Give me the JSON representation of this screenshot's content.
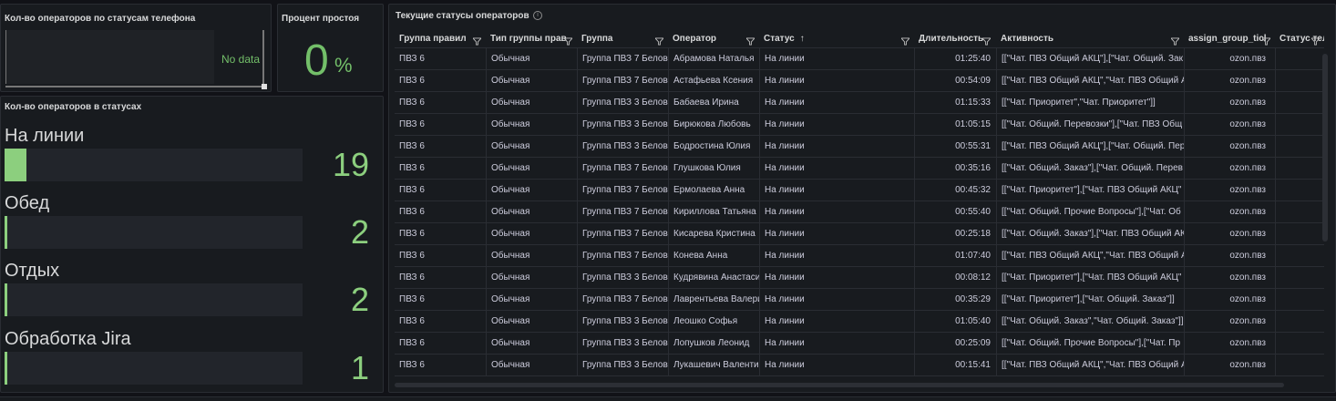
{
  "phone_panel": {
    "title": "Кол-во операторов по статусам телефона",
    "no_data": "No data"
  },
  "idle_panel": {
    "title": "Процент простоя",
    "value": "0",
    "unit": "%"
  },
  "status_panel": {
    "title": "Кол-во операторов в статусах",
    "max": 19,
    "items": [
      {
        "label": "На линии",
        "value": "19",
        "fraction": 0.074
      },
      {
        "label": "Обед",
        "value": "2",
        "fraction": 0.01
      },
      {
        "label": "Отдых",
        "value": "2",
        "fraction": 0.01
      },
      {
        "label": "Обработка Jira",
        "value": "1",
        "fraction": 0.005
      }
    ]
  },
  "table_panel": {
    "title": "Текущие статусы операторов",
    "info_icon": "info-icon",
    "filter_icon": "filter-icon",
    "columns": [
      "Группа правил",
      "Тип группы прав",
      "Группа",
      "Оператор",
      "Статус",
      "Длительность",
      "Активность",
      "assign_group_ticl",
      "Статус теле"
    ],
    "sort_indicator": "↑",
    "rows": [
      [
        "ПВЗ 6",
        "Обычная",
        "Группа ПВЗ 7 Белов",
        "Абрамова Наталья",
        "На линии",
        "01:25:40",
        "[[\"Чат. ПВЗ Общий АКЦ\"],[\"Чат. Общий. Зак",
        "ozon.пвз"
      ],
      [
        "ПВЗ 6",
        "Обычная",
        "Группа ПВЗ 7 Белов",
        "Астафьева Ксения",
        "На линии",
        "00:54:09",
        "[[\"Чат. ПВЗ Общий АКЦ\",\"Чат. ПВЗ Общий А",
        "ozon.пвз"
      ],
      [
        "ПВЗ 6",
        "Обычная",
        "Группа ПВЗ 3 Белов",
        "Бабаева Ирина",
        "На линии",
        "01:15:33",
        "[[\"Чат. Приоритет\",\"Чат. Приоритет\"]]",
        "ozon.пвз"
      ],
      [
        "ПВЗ 6",
        "Обычная",
        "Группа ПВЗ 3 Белов",
        "Бирюкова Любовь",
        "На линии",
        "01:05:15",
        "[[\"Чат. Общий. Перевозки\"],[\"Чат. ПВЗ Общ",
        "ozon.пвз"
      ],
      [
        "ПВЗ 6",
        "Обычная",
        "Группа ПВЗ 3 Белов",
        "Бодростина Юлия",
        "На линии",
        "00:55:31",
        "[[\"Чат. ПВЗ Общий АКЦ\"],[\"Чат. Общий. Пер",
        "ozon.пвз"
      ],
      [
        "ПВЗ 6",
        "Обычная",
        "Группа ПВЗ 7 Белов",
        "Глушкова Юлия",
        "На линии",
        "00:35:16",
        "[[\"Чат. Общий. Заказ\"],[\"Чат. Общий. Перев",
        "ozon.пвз"
      ],
      [
        "ПВЗ 6",
        "Обычная",
        "Группа ПВЗ 7 Белов",
        "Ермолаева Анна",
        "На линии",
        "00:45:32",
        "[[\"Чат. Приоритет\"],[\"Чат. ПВЗ Общий АКЦ\"",
        "ozon.пвз"
      ],
      [
        "ПВЗ 6",
        "Обычная",
        "Группа ПВЗ 7 Белов",
        "Кириллова Татьяна",
        "На линии",
        "00:55:40",
        "[[\"Чат. Общий. Прочие Вопросы\"],[\"Чат. Об",
        "ozon.пвз"
      ],
      [
        "ПВЗ 6",
        "Обычная",
        "Группа ПВЗ 7 Белов",
        "Кисарева Кристина",
        "На линии",
        "00:25:18",
        "[[\"Чат. Общий. Заказ\"],[\"Чат. ПВЗ Общий АК",
        "ozon.пвз"
      ],
      [
        "ПВЗ 6",
        "Обычная",
        "Группа ПВЗ 7 Белов",
        "Конева Анна",
        "На линии",
        "01:07:40",
        "[[\"Чат. ПВЗ Общий АКЦ\",\"Чат. ПВЗ Общий А",
        "ozon.пвз"
      ],
      [
        "ПВЗ 6",
        "Обычная",
        "Группа ПВЗ 3 Белов",
        "Кудрявина Анастаси",
        "На линии",
        "00:08:12",
        "[[\"Чат. Приоритет\"],[\"Чат. ПВЗ Общий АКЦ\"",
        "ozon.пвз"
      ],
      [
        "ПВЗ 6",
        "Обычная",
        "Группа ПВЗ 7 Белов",
        "Лаврентьева Валери",
        "На линии",
        "00:35:29",
        "[[\"Чат. Приоритет\"],[\"Чат. Общий. Заказ\"]]",
        "ozon.пвз"
      ],
      [
        "ПВЗ 6",
        "Обычная",
        "Группа ПВЗ 3 Белов",
        "Леошко Софья",
        "На линии",
        "01:05:40",
        "[[\"Чат. Общий. Заказ\",\"Чат. Общий. Заказ\"]]",
        "ozon.пвз"
      ],
      [
        "ПВЗ 6",
        "Обычная",
        "Группа ПВЗ 3 Белов",
        "Лопушков Леонид",
        "На линии",
        "00:25:09",
        "[[\"Чат. Общий. Прочие Вопросы\"],[\"Чат. Пр",
        "ozon.пвз"
      ],
      [
        "ПВЗ 6",
        "Обычная",
        "Группа ПВЗ 3 Белов",
        "Лукашевич Валенти",
        "На линии",
        "00:15:41",
        "[[\"Чат. ПВЗ Общий АКЦ\",\"Чат. ПВЗ Общий А",
        "ozon.пвз"
      ]
    ]
  }
}
